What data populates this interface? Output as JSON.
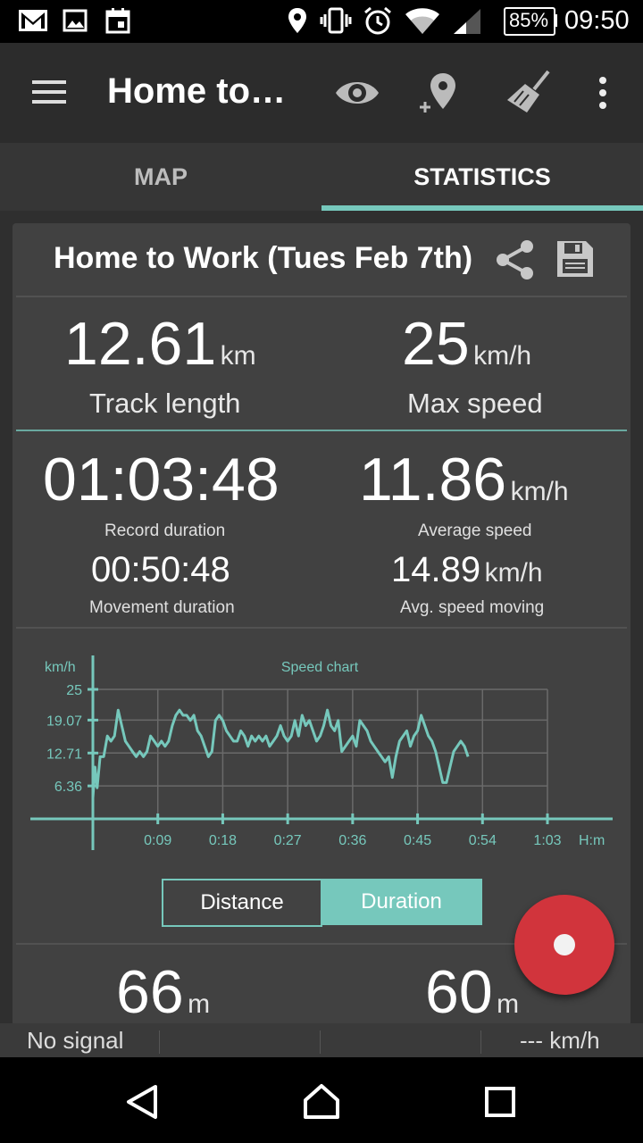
{
  "status_bar": {
    "battery_percent": "85%",
    "time": "09:50"
  },
  "app_bar": {
    "title": "Home to…"
  },
  "tabs": [
    {
      "label": "MAP",
      "selected": false
    },
    {
      "label": "STATISTICS",
      "selected": true
    }
  ],
  "card": {
    "title": "Home to Work (Tues Feb 7th)",
    "track_length": {
      "value": "12.61",
      "unit": "km",
      "label": "Track length"
    },
    "max_speed": {
      "value": "25",
      "unit": "km/h",
      "label": "Max speed"
    },
    "record_duration": {
      "value": "01:03:48",
      "label": "Record duration"
    },
    "average_speed": {
      "value": "11.86",
      "unit": "km/h",
      "label": "Average speed"
    },
    "movement_duration": {
      "value": "00:50:48",
      "label": "Movement duration"
    },
    "avg_speed_moving": {
      "value": "14.89",
      "unit": "km/h",
      "label": "Avg. speed moving"
    },
    "elevation_left": {
      "value": "66",
      "unit": "m"
    },
    "elevation_right": {
      "value": "60",
      "unit": "m"
    }
  },
  "toggle": {
    "distance_label": "Distance",
    "duration_label": "Duration",
    "selected": "Duration"
  },
  "bottom_status": {
    "signal": "No signal",
    "speed": "--- km/h"
  },
  "colors": {
    "accent": "#76c8bc",
    "record_button": "#d1343c",
    "card_bg": "#414141"
  },
  "chart_data": {
    "type": "line",
    "title": "Speed chart",
    "ylabel": "km/h",
    "xlabel": "H:m",
    "x_tick_labels": [
      "0:09",
      "0:18",
      "0:27",
      "0:36",
      "0:45",
      "0:54",
      "1:03"
    ],
    "y_tick_labels": [
      "6.36",
      "12.71",
      "19.07",
      "25"
    ],
    "ylim": [
      0,
      25
    ],
    "xlim_minutes": [
      0,
      63.8
    ],
    "grid": true,
    "series": [
      {
        "x_minutes": [
          0,
          0.3,
          0.6,
          1,
          1.5,
          2,
          2.5,
          3,
          3.5,
          4,
          4.5,
          5,
          5.5,
          6,
          6.5,
          7,
          7.5,
          8,
          8.5,
          9,
          9.5,
          10,
          10.5,
          11,
          11.5,
          12,
          12.5,
          13,
          13.5,
          14,
          14.5,
          15,
          15.5,
          16,
          16.5,
          17,
          17.5,
          18,
          18.5,
          19,
          19.5,
          20,
          20.5,
          21,
          21.5,
          22,
          22.5,
          23,
          23.5,
          24,
          24.5,
          25,
          25.5,
          26,
          26.5,
          27,
          27.5,
          28,
          28.5,
          29,
          29.5,
          30,
          30.5,
          31,
          31.5,
          32,
          32.5,
          33,
          33.5,
          34,
          34.5,
          35,
          35.5,
          36,
          36.5,
          37,
          37.5,
          38,
          38.5,
          39,
          39.5,
          40,
          40.5,
          41,
          41.5,
          42,
          42.5,
          43,
          43.5,
          44,
          44.5,
          45,
          45.5,
          46,
          46.5,
          47,
          47.5,
          48,
          48.5,
          49,
          49.5,
          50,
          50.5,
          51,
          51.5,
          52
        ],
        "y_kmh": [
          4,
          10,
          6,
          12,
          12,
          16,
          15,
          16,
          21,
          18,
          15,
          14,
          13,
          12,
          13,
          12,
          13,
          16,
          15,
          14,
          15,
          14,
          15,
          18,
          20,
          21,
          20,
          20,
          19,
          20,
          17,
          16,
          14,
          12,
          13,
          19,
          20,
          19,
          17,
          16,
          15,
          15,
          17,
          16,
          14,
          16,
          15,
          16,
          15,
          16,
          14,
          15,
          16,
          18,
          16,
          15,
          16,
          19,
          16,
          20,
          18,
          19,
          17,
          15,
          16,
          18,
          21,
          18,
          17,
          19,
          13,
          14,
          15,
          16,
          14,
          19,
          18,
          17,
          15,
          14,
          13,
          12,
          11,
          12,
          8,
          12,
          15,
          16,
          17,
          14,
          16,
          17,
          20,
          18,
          16,
          15,
          13,
          10,
          7,
          7,
          10,
          13,
          14,
          15,
          14,
          12
        ]
      }
    ]
  }
}
